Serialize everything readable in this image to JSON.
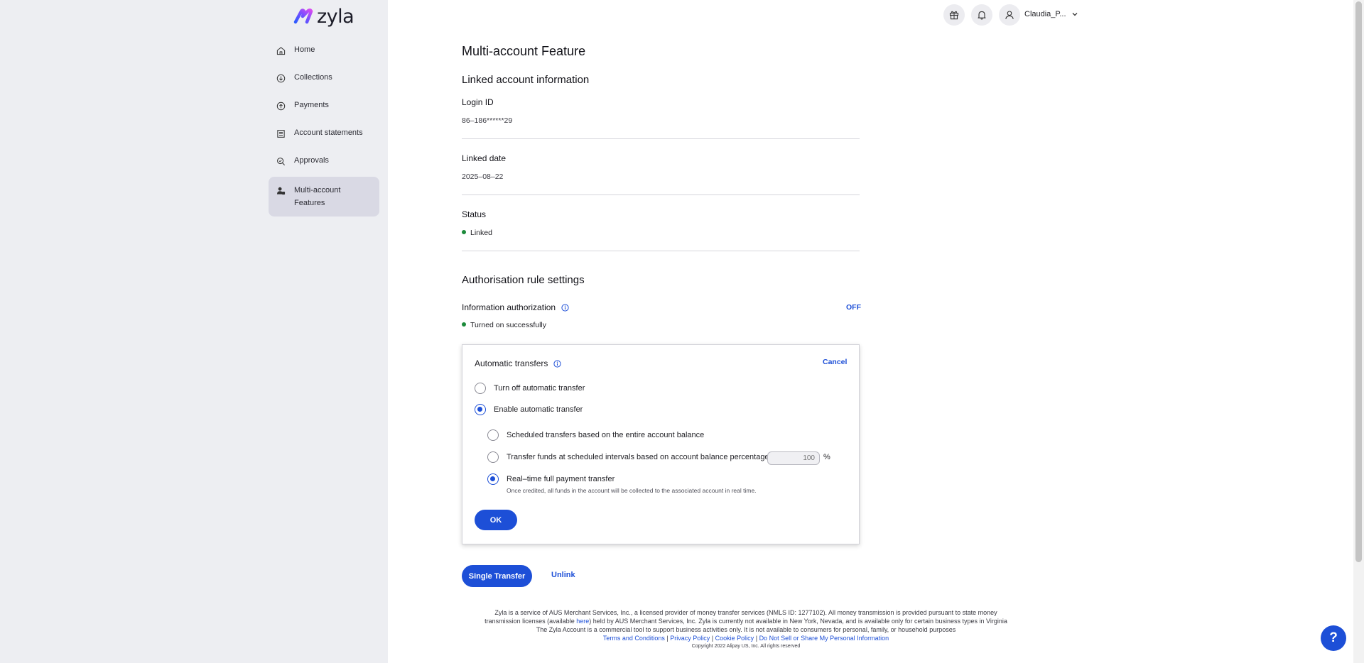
{
  "brand": {
    "name": "zyla"
  },
  "sidebar": {
    "items": [
      {
        "label": "Home",
        "icon": "home-icon"
      },
      {
        "label": "Collections",
        "icon": "collections-icon"
      },
      {
        "label": "Payments",
        "icon": "payments-icon"
      },
      {
        "label": "Account statements",
        "icon": "statements-icon"
      },
      {
        "label": "Approvals",
        "icon": "approvals-icon"
      },
      {
        "label_line1": "Multi-account",
        "label_line2": "Features",
        "icon": "multi-account-icon",
        "active": true
      }
    ]
  },
  "header": {
    "user_name": "Claudia_P..."
  },
  "page": {
    "title": "Multi-account Feature",
    "linked_section_title": "Linked account information",
    "fields": [
      {
        "label": "Login ID",
        "value": "86–186******29"
      },
      {
        "label": "Linked date",
        "value": "2025–08–22"
      },
      {
        "label": "Status",
        "value": "Linked",
        "status_color": "#1b8a3a"
      }
    ],
    "auth_section_title": "Authorisation rule settings",
    "info_auth": {
      "label": "Information authorization",
      "toggle": "OFF",
      "status": "Turned on successfully"
    }
  },
  "panel": {
    "title": "Automatic transfers",
    "cancel": "Cancel",
    "options": [
      {
        "label": "Turn off automatic transfer",
        "selected": false
      },
      {
        "label": "Enable automatic transfer",
        "selected": true
      }
    ],
    "sub_options": [
      {
        "label": "Scheduled transfers based on the entire account balance",
        "selected": false
      },
      {
        "label": "Transfer funds at scheduled intervals based on account balance percentage.",
        "selected": false,
        "input_placeholder": "100",
        "unit": "%"
      },
      {
        "label": "Real–time full payment transfer",
        "selected": true,
        "description": "Once credited, all funds in the account will be collected to the associated account in real time."
      }
    ],
    "ok": "OK"
  },
  "actions": {
    "single_transfer": "Single Transfer",
    "unlink": "Unlink"
  },
  "footer": {
    "line1": "Zyla is a service of AUS Merchant Services, Inc., a licensed provider of money transfer services (NMLS ID: 1277102). All money transmission is provided pursuant to state money",
    "line2_pre": "transmission licenses (available ",
    "line2_link": "here",
    "line2_post": ") held by AUS Merchant Services, Inc. Zyla is currently not available in New York, Nevada, and is available only for certain business types in Virginia",
    "line3": "The Zyla Account is a commercial tool to support business activities only. It is not available to consumers for personal, family, or household purposes",
    "links": [
      "Terms and Conditions",
      "Privacy Policy",
      "Cookie Policy",
      "Do Not Sell or Share My Personal Information"
    ],
    "separator": "|",
    "copyright": "Copyright 2022 Alipay US, Inc. All rights reserved"
  },
  "help": {
    "label": "?"
  },
  "colors": {
    "accent": "#1d4fd7",
    "sidebar_bg": "#edeef2",
    "active_nav_bg": "#d9d9e4",
    "success": "#1b8a3a"
  }
}
